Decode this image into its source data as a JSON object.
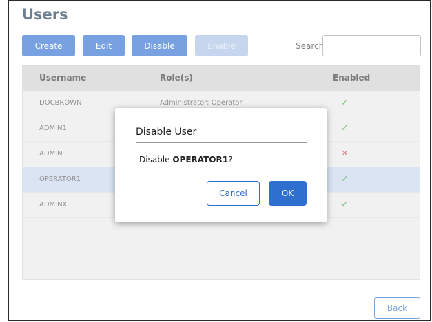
{
  "page": {
    "title": "Users"
  },
  "toolbar": {
    "create_label": "Create",
    "edit_label": "Edit",
    "disable_label": "Disable",
    "enable_label": "Enable",
    "search_label": "Search:",
    "search_value": ""
  },
  "table": {
    "headers": {
      "username": "Username",
      "roles": "Role(s)",
      "enabled": "Enabled"
    },
    "rows": [
      {
        "username": "DOCBROWN",
        "roles": "Administrator; Operator",
        "enabled": "✓",
        "enabled_state": true
      },
      {
        "username": "ADMIN1",
        "roles": "",
        "enabled": "✓",
        "enabled_state": true
      },
      {
        "username": "ADMIN",
        "roles": "",
        "enabled": "✕",
        "enabled_state": false
      },
      {
        "username": "OPERATOR1",
        "roles": "",
        "enabled": "✓",
        "enabled_state": true,
        "selected": true
      },
      {
        "username": "ADMINX",
        "roles": "",
        "enabled": "✓",
        "enabled_state": true
      }
    ]
  },
  "footer": {
    "back_label": "Back"
  },
  "dialog": {
    "title": "Disable User",
    "message_prefix": "Disable ",
    "message_target": "OPERATOR1",
    "message_suffix": "?",
    "cancel_label": "Cancel",
    "ok_label": "OK"
  },
  "colors": {
    "primary": "#2e6fd0",
    "selected_row": "#c6d6ec",
    "check": "#3c9a3c",
    "cross": "#d04040"
  }
}
